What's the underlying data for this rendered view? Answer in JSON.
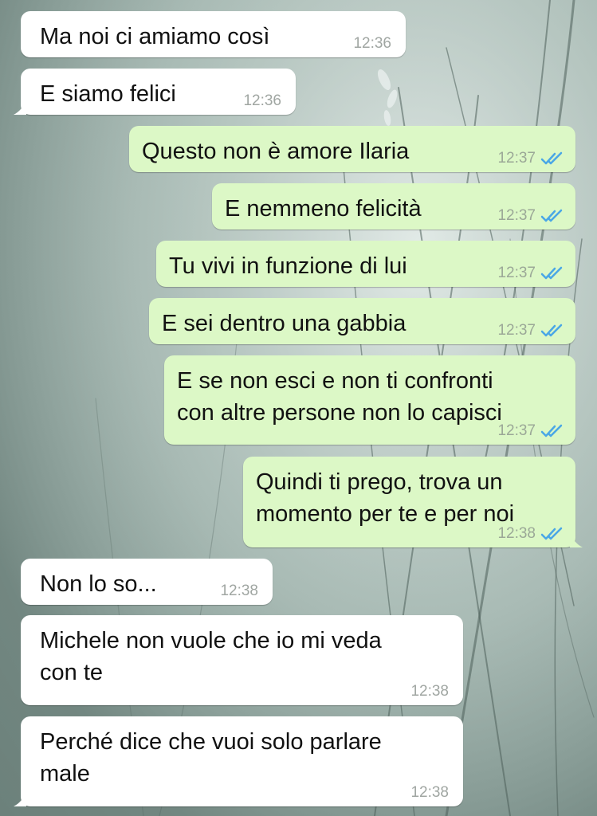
{
  "messages": [
    {
      "dir": "in",
      "text": "Ma noi ci amiamo così",
      "time": "12:36"
    },
    {
      "dir": "in",
      "text": "E siamo felici",
      "time": "12:36"
    },
    {
      "dir": "out",
      "text": "Questo non è amore Ilaria",
      "time": "12:37",
      "status": "read"
    },
    {
      "dir": "out",
      "text": "E nemmeno felicità",
      "time": "12:37",
      "status": "read"
    },
    {
      "dir": "out",
      "text": "Tu vivi in funzione di lui",
      "time": "12:37",
      "status": "read"
    },
    {
      "dir": "out",
      "text": "E sei dentro una gabbia",
      "time": "12:37",
      "status": "read"
    },
    {
      "dir": "out",
      "text": "E se non esci e non ti confronti\ncon altre persone non lo capisci",
      "time": "12:37",
      "status": "read"
    },
    {
      "dir": "out",
      "text": "Quindi ti prego, trova un\nmomento per te e per noi",
      "time": "12:38",
      "status": "read"
    },
    {
      "dir": "in",
      "text": "Non lo so...",
      "time": "12:38"
    },
    {
      "dir": "in",
      "text": "Michele non vuole che io mi veda\ncon te",
      "time": "12:38"
    },
    {
      "dir": "in",
      "text": "Perché dice che vuoi solo parlare\nmale",
      "time": "12:38"
    }
  ],
  "colors": {
    "incoming_bubble": "#ffffff",
    "outgoing_bubble": "#dcf8c6",
    "read_ticks": "#4aa7e6"
  },
  "icons": {
    "read_status": "double-check-icon"
  }
}
